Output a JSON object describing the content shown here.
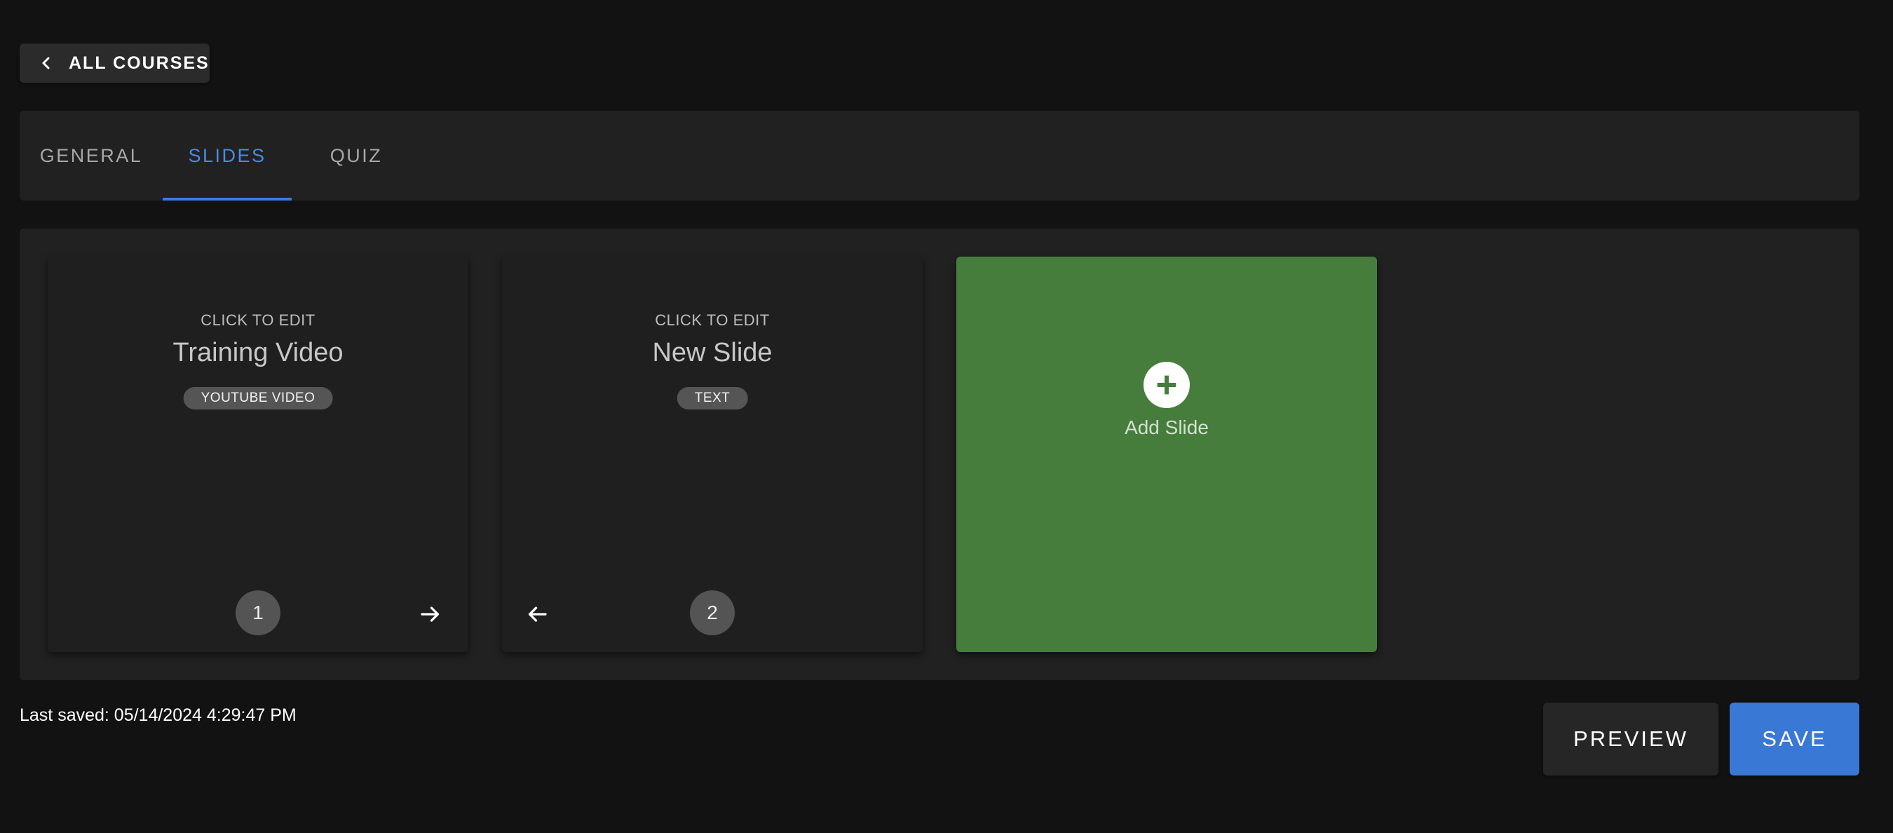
{
  "back_button": {
    "label": "ALL COURSES",
    "icon": "chevron-left-icon"
  },
  "tabs": [
    {
      "label": "GENERAL",
      "active": false
    },
    {
      "label": "SLIDES",
      "active": true
    },
    {
      "label": "QUIZ",
      "active": false
    }
  ],
  "slides": [
    {
      "hint": "CLICK TO EDIT",
      "title": "Training Video",
      "type": "YOUTUBE VIDEO",
      "number": "1"
    },
    {
      "hint": "CLICK TO EDIT",
      "title": "New Slide",
      "type": "TEXT",
      "number": "2"
    }
  ],
  "add_slide": {
    "label": "Add Slide",
    "icon": "plus-circle-icon"
  },
  "footer": {
    "last_saved": "Last saved: 05/14/2024 4:29:47 PM",
    "preview_label": "PREVIEW",
    "save_label": "SAVE"
  },
  "colors": {
    "background": "#121212",
    "surface": "#212121",
    "accent": "#3a78d6",
    "add_card": "#467d3c"
  }
}
